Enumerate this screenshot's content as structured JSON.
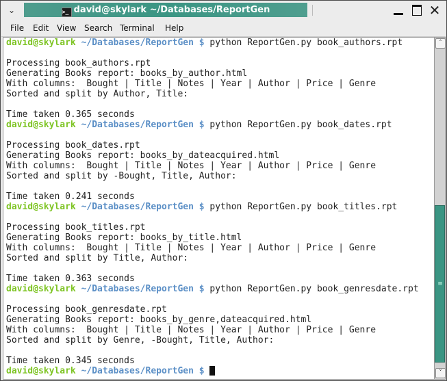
{
  "window": {
    "title": "david@skylark ~/Databases/ReportGen",
    "title_icon": "terminal-icon",
    "menu_icon": "chevron-down-icon",
    "controls": {
      "minimize": "minimize-icon",
      "maximize": "maximize-icon",
      "close": "close-icon"
    },
    "accent_color": "#3b9583"
  },
  "menubar": {
    "items": [
      "File",
      "Edit",
      "View",
      "Search",
      "Terminal",
      "Help"
    ]
  },
  "terminal": {
    "prompt_user": "david@skylark",
    "prompt_path": "~/Databases/ReportGen $",
    "prompt_user_color": "#7ec424",
    "prompt_path_color": "#5b8fc6",
    "lines": [
      {
        "type": "prompt",
        "cmd": " python ReportGen.py book_authors.rpt"
      },
      {
        "type": "text",
        "text": ""
      },
      {
        "type": "text",
        "text": "Processing book_authors.rpt"
      },
      {
        "type": "text",
        "text": "Generating Books report: books_by_author.html"
      },
      {
        "type": "text",
        "text": "With columns:  Bought | Title | Notes | Year | Author | Price | Genre"
      },
      {
        "type": "text",
        "text": "Sorted and split by Author, Title:"
      },
      {
        "type": "text",
        "text": ""
      },
      {
        "type": "text",
        "text": "Time taken 0.365 seconds"
      },
      {
        "type": "prompt",
        "cmd": " python ReportGen.py book_dates.rpt"
      },
      {
        "type": "text",
        "text": ""
      },
      {
        "type": "text",
        "text": "Processing book_dates.rpt"
      },
      {
        "type": "text",
        "text": "Generating Books report: books_by_dateacquired.html"
      },
      {
        "type": "text",
        "text": "With columns:  Bought | Title | Notes | Year | Author | Price | Genre"
      },
      {
        "type": "text",
        "text": "Sorted and split by -Bought, Title, Author:"
      },
      {
        "type": "text",
        "text": ""
      },
      {
        "type": "text",
        "text": "Time taken 0.241 seconds"
      },
      {
        "type": "prompt",
        "cmd": " python ReportGen.py book_titles.rpt"
      },
      {
        "type": "text",
        "text": ""
      },
      {
        "type": "text",
        "text": "Processing book_titles.rpt"
      },
      {
        "type": "text",
        "text": "Generating Books report: books_by_title.html"
      },
      {
        "type": "text",
        "text": "With columns:  Bought | Title | Notes | Year | Author | Price | Genre"
      },
      {
        "type": "text",
        "text": "Sorted and split by Title, Author:"
      },
      {
        "type": "text",
        "text": ""
      },
      {
        "type": "text",
        "text": "Time taken 0.363 seconds"
      },
      {
        "type": "prompt",
        "cmd": " python ReportGen.py book_genresdate.rpt"
      },
      {
        "type": "text",
        "text": ""
      },
      {
        "type": "text",
        "text": "Processing book_genresdate.rpt"
      },
      {
        "type": "text",
        "text": "Generating Books report: books_by_genre,dateacquired.html"
      },
      {
        "type": "text",
        "text": "With columns:  Bought | Title | Notes | Year | Author | Price | Genre"
      },
      {
        "type": "text",
        "text": "Sorted and split by Genre, -Bought, Title, Author:"
      },
      {
        "type": "text",
        "text": ""
      },
      {
        "type": "text",
        "text": "Time taken 0.345 seconds"
      },
      {
        "type": "prompt",
        "cmd": " ",
        "cursor": true
      }
    ]
  },
  "scrollbar": {
    "up_icon": "˄",
    "down_icon": "˅",
    "grip": "≡",
    "thumb_start_fraction": 0.49,
    "thumb_size_fraction": 0.49
  }
}
